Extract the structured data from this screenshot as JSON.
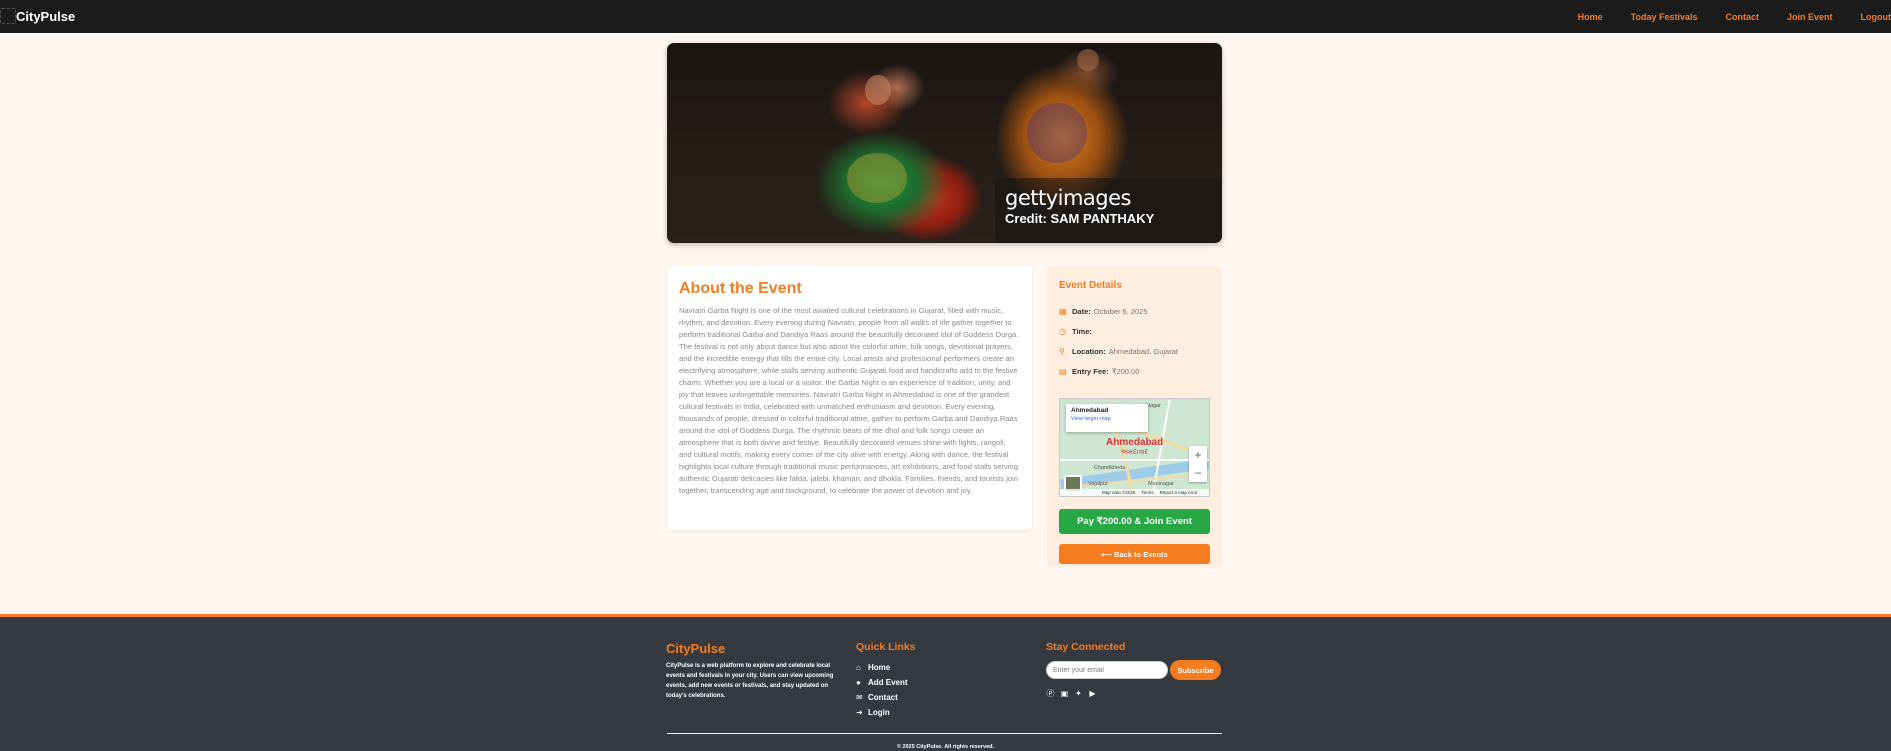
{
  "navbar": {
    "brand": "CityPulse",
    "links": [
      "Home",
      "Today Festivals",
      "Contact",
      "Join Event",
      "Logout"
    ]
  },
  "hero": {
    "watermark": "gettyimages",
    "credit": "Credit: SAM PANTHAKY"
  },
  "about": {
    "title": "About the Event",
    "body": "Navratri Garba Night is one of the most awaited cultural celebrations in Gujarat, filled with music, rhythm, and devotion. Every evening during Navratri, people from all walks of life gather together to perform traditional Garba and Dandiya Raas around the beautifully decorated idol of Goddess Durga. The festival is not only about dance but also about the colorful attire, folk songs, devotional prayers, and the incredible energy that fills the entire city. Local artists and professional performers create an electrifying atmosphere, while stalls serving authentic Gujarati food and handicrafts add to the festive charm. Whether you are a local or a visitor, the Garba Night is an experience of tradition, unity, and joy that leaves unforgettable memories. Navratri Garba Night in Ahmedabad is one of the grandest cultural festivals in India, celebrated with unmatched enthusiasm and devotion. Every evening, thousands of people, dressed in colorful traditional attire, gather to perform Garba and Dandiya Raas around the idol of Goddess Durga. The rhythmic beats of the dhol and folk songs create an atmosphere that is both divine and festive. Beautifully decorated venues shine with lights, rangoli, and cultural motifs, making every corner of the city alive with energy. Along with dance, the festival highlights local culture through traditional music performances, art exhibitions, and food stalls serving authentic Gujarati delicacies like fafda, jalebi, khaman, and dhokla. Families, friends, and tourists join together, transcending age and background, to celebrate the power of devotion and joy."
  },
  "details": {
    "title": "Event Details",
    "date_label": "Date:",
    "date_value": "October 5, 2025",
    "time_label": "Time:",
    "time_value": "",
    "location_label": "Location:",
    "location_value": "Ahmedabad, Gujarat",
    "fee_label": "Entry Fee:",
    "fee_value": "₹200.00",
    "icons": [
      "calendar-icon",
      "clock-icon",
      "map-pin-icon",
      "receipt-icon"
    ]
  },
  "map": {
    "popup_title": "Ahmedabad",
    "popup_link": "View larger map",
    "city": "Ahmedabad",
    "city_local": "અમદાવાદ",
    "label_top": "Nagar",
    "label_left": "Chandkheda",
    "label_bottom": "Maninagar",
    "label_veraval": "Vejalpur",
    "map_data": "Map data ©2025",
    "terms": "Terms",
    "report": "Report a map error"
  },
  "actions": {
    "pay_label": "Pay ₹200.00 & Join Event",
    "back_label": "⟵ Back to Events"
  },
  "footer": {
    "brand": "CityPulse",
    "about": "CityPulse is a web platform to explore and celebrate local events and festivals in your city. Users can view upcoming events, add new events or festivals, and stay updated on today's celebrations.",
    "quick_links_title": "Quick Links",
    "quick_links": [
      "Home",
      "Add Event",
      "Contact",
      "Login"
    ],
    "quick_link_icons": [
      "home-icon",
      "plus-circle-icon",
      "envelope-icon",
      "login-icon"
    ],
    "stay_connected_title": "Stay Connected",
    "email_placeholder": "Enter your email",
    "subscribe_label": "Subscribe",
    "social_icons": [
      "facebook-icon",
      "instagram-icon",
      "twitter-icon",
      "youtube-icon"
    ],
    "copyright": "© 2025 CityPulse. All rights reserved."
  },
  "colors": {
    "accent": "#f57c1f",
    "navbar_bg": "#1b1b1b",
    "page_bg": "#fff7f0",
    "footer_bg": "#343a40",
    "pay_button": "#28a745"
  }
}
